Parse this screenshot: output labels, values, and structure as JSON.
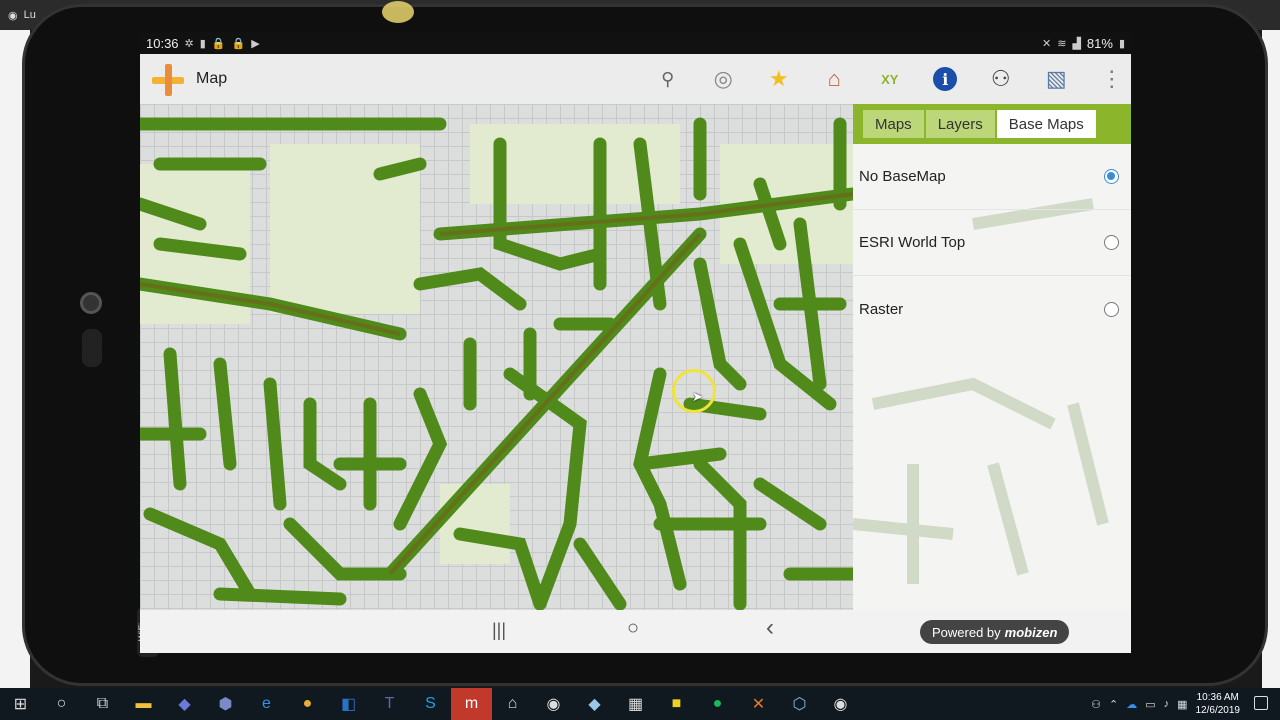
{
  "desktop": {
    "tab_title": "Lu",
    "window_controls": [
      "🔒",
      "🔔",
      "—",
      "✕"
    ]
  },
  "status_bar": {
    "time": "10:36",
    "battery": "81%"
  },
  "app_bar": {
    "title": "Map",
    "toolbar_icons": [
      "search-icon",
      "locate-icon",
      "favorites-star-icon",
      "building-icon",
      "xy-coordinates-icon",
      "info-icon",
      "binoculars-icon",
      "map-tools-icon",
      "more-vert-icon"
    ]
  },
  "panel": {
    "tabs": [
      {
        "label": "Maps",
        "active": false
      },
      {
        "label": "Layers",
        "active": false
      },
      {
        "label": "Base Maps",
        "active": true
      }
    ],
    "options": [
      {
        "label": "No BaseMap",
        "selected": true
      },
      {
        "label": "ESRI World Top",
        "selected": false
      },
      {
        "label": "Raster",
        "selected": false
      }
    ]
  },
  "navbar": {
    "recent": "|||",
    "home": "○",
    "back": "‹",
    "powered_by": "Powered by",
    "brand": "mobizen"
  },
  "taskbar": {
    "time": "10:36 AM",
    "date": "12/6/2019"
  },
  "colors": {
    "tab_bar": "#8bb52a",
    "network_green": "#4f8a1a",
    "radio_selected": "#3a8bd8"
  }
}
